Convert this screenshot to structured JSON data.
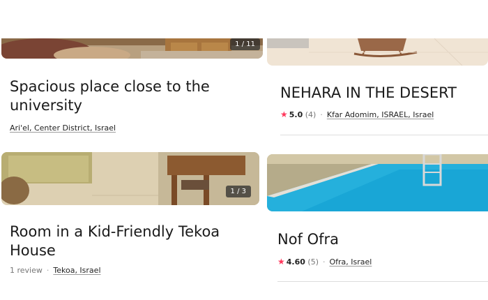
{
  "listings": [
    {
      "title": "Spacious place close to the university",
      "photo_counter": "1 / 11",
      "location": "Ari'el, Center District, Israel"
    },
    {
      "title": "NEHARA IN THE DESERT",
      "rating": "5.0",
      "reviews": "(4)",
      "location": "Kfar Adomim, ISRAEL, Israel"
    },
    {
      "title": "Room in a Kid-Friendly Tekoa House",
      "photo_counter": "1 / 3",
      "reviews_text": "1 review",
      "location": "Tekoa, Israel"
    },
    {
      "title": "Nof Ofra",
      "rating": "4.60",
      "reviews": "(5)",
      "location": "Ofra, Israel"
    }
  ],
  "colors": {
    "star": "#ff385c",
    "pool": "#25b0dc"
  },
  "icons": {
    "star": "star-icon"
  }
}
